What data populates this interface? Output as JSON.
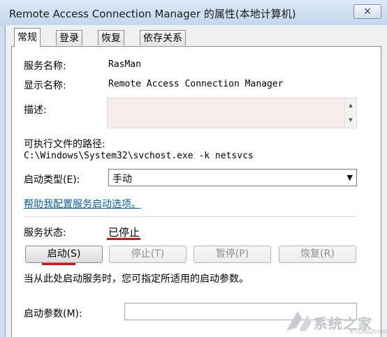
{
  "window": {
    "title": "Remote Access Connection Manager 的属性(本地计算机)",
    "close_glyph": "✕"
  },
  "tabs": [
    {
      "label": "常规",
      "active": true
    },
    {
      "label": "登录",
      "active": false
    },
    {
      "label": "恢复",
      "active": false
    },
    {
      "label": "依存关系",
      "active": false
    }
  ],
  "general": {
    "service_name_label": "服务名称:",
    "service_name": "RasMan",
    "display_name_label": "显示名称:",
    "display_name": "Remote Access Connection Manager",
    "description_label": "描述:",
    "description": "",
    "exe_path_label": "可执行文件的路径:",
    "exe_path": "C:\\Windows\\System32\\svchost.exe -k netsvcs",
    "startup_type_label": "启动类型(E):",
    "startup_type_value": "手动",
    "help_link": "帮助我配置服务启动选项。",
    "service_status_label": "服务状态:",
    "service_status": "已停止",
    "buttons": {
      "start": "启动(S)",
      "stop": "停止(T)",
      "pause": "暂停(P)",
      "resume": "恢复(R)"
    },
    "hint": "当从此处启动服务时，您可指定所适用的启动参数。",
    "start_params_label": "启动参数(M):",
    "start_params_value": ""
  },
  "watermark": {
    "text": "系统之家",
    "url": "XITONGZHIJIA.NET"
  },
  "colors": {
    "highlight_underline": "#d8101a",
    "link": "#0a5ea8"
  }
}
